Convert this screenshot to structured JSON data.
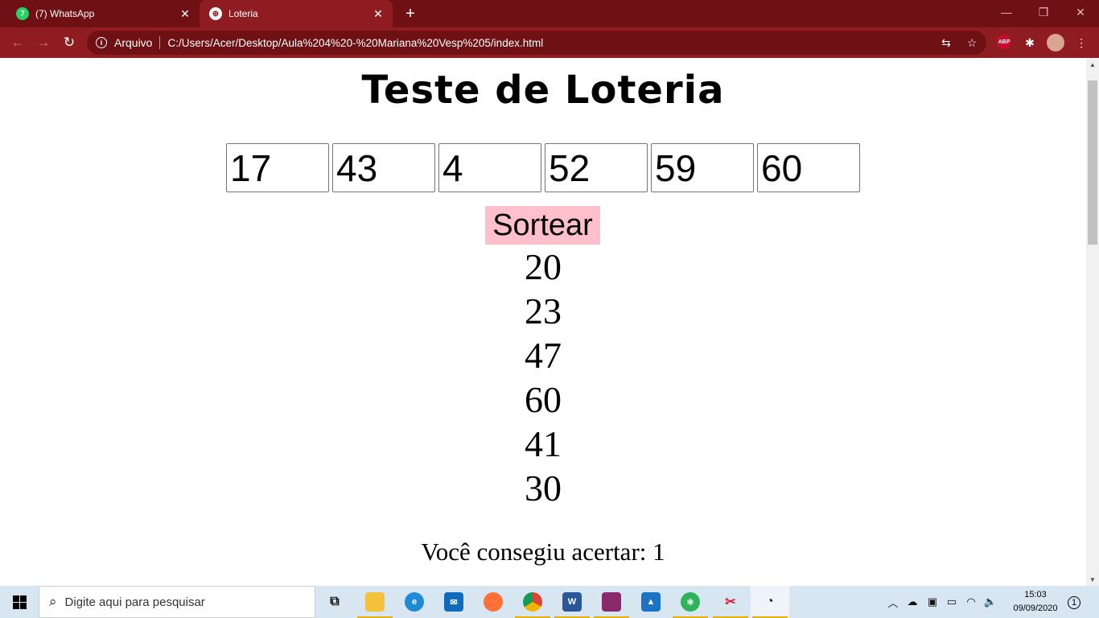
{
  "browser": {
    "tabs": [
      {
        "title": "(7) WhatsApp",
        "favicon": "7",
        "active": false
      },
      {
        "title": "Loteria",
        "favicon": "⊕",
        "active": true
      }
    ],
    "new_tab_label": "+",
    "url_prefix": "Arquivo",
    "url": "C:/Users/Acer/Desktop/Aula%204%20-%20Mariana%20Vesp%205/index.html",
    "extension_badge": "ABP",
    "colors": {
      "frame": "#6e1014",
      "toolbar": "#8f1c21"
    }
  },
  "page": {
    "title": "Teste de Loteria",
    "inputs": [
      "17",
      "43",
      "4",
      "52",
      "59",
      "60"
    ],
    "button_label": "Sortear",
    "drawn_numbers": [
      "20",
      "23",
      "47",
      "60",
      "41",
      "30"
    ],
    "result_text": "Você consegiu acertar: 1",
    "colors": {
      "button_bg": "#ffc0cb"
    }
  },
  "taskbar": {
    "search_placeholder": "Digite aqui para pesquisar",
    "apps": [
      "task-view",
      "file-explorer",
      "edge",
      "mail",
      "firefox",
      "chrome",
      "word",
      "winrar",
      "photos",
      "atom",
      "snipping-tool",
      "active-app"
    ],
    "time": "15:03",
    "date": "09/09/2020",
    "notification_count": "1"
  }
}
